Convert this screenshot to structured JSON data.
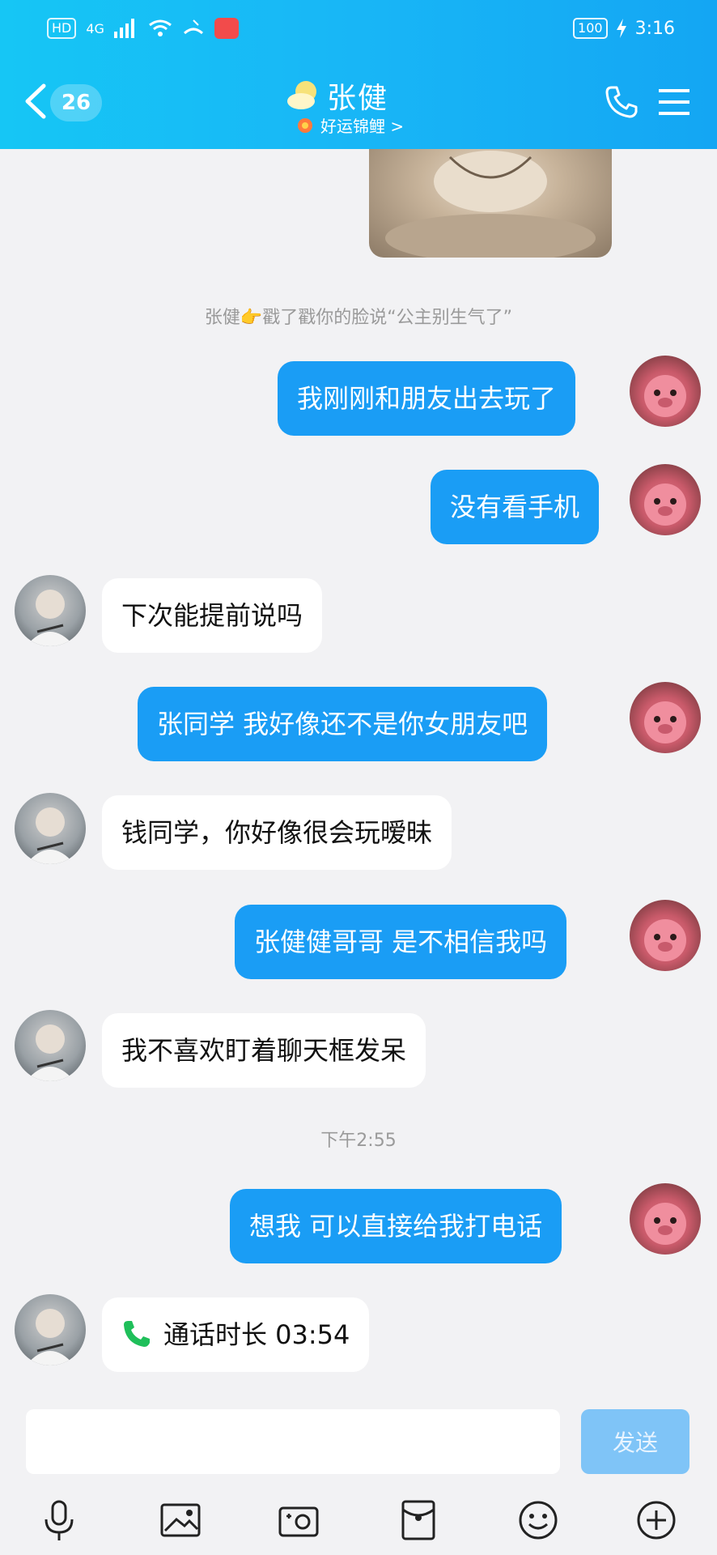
{
  "status_bar": {
    "network_chip": "HD",
    "signal": "4G",
    "battery": "100",
    "time": "3:16"
  },
  "header": {
    "unread_count": "26",
    "contact_name": "张健",
    "subtitle": "好运锦鲤 >"
  },
  "chat": {
    "system_note": "张健👉戳了戳你的脸说“公主别生气了”",
    "timestamp": "下午2:55",
    "messages": [
      {
        "from": "me",
        "text": "我刚刚和朋友出去玩了"
      },
      {
        "from": "me",
        "text": "没有看手机"
      },
      {
        "from": "other",
        "text": "下次能提前说吗"
      },
      {
        "from": "me",
        "text": "张同学 我好像还不是你女朋友吧"
      },
      {
        "from": "other",
        "text": "钱同学，你好像很会玩暧昧"
      },
      {
        "from": "me",
        "text": "张健健哥哥 是不相信我吗"
      },
      {
        "from": "other",
        "text": "我不喜欢盯着聊天框发呆"
      },
      {
        "from": "me",
        "text": "想我 可以直接给我打电话"
      },
      {
        "from": "other",
        "text": "通话时长 03:54"
      }
    ]
  },
  "input": {
    "value": "",
    "send_label": "发送"
  },
  "colors": {
    "header_gradient_start": "#16c6f5",
    "outgoing_bubble": "#1a9df5",
    "call_icon_green": "#1fbf5a"
  },
  "toolbar_icons": [
    "microphone-icon",
    "image-icon",
    "camera-icon",
    "red-packet-icon",
    "emoji-icon",
    "plus-icon"
  ]
}
